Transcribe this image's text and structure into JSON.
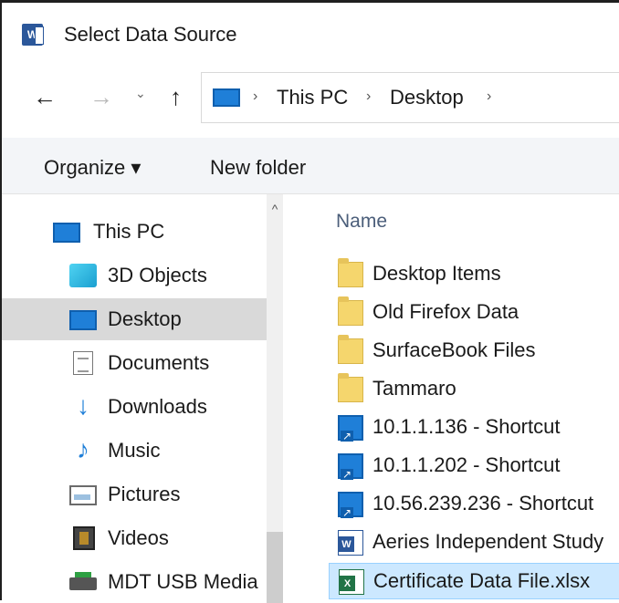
{
  "window": {
    "title": "Select Data Source",
    "app_icon": "word-icon"
  },
  "nav": {
    "back": "←",
    "forward": "→",
    "recent": "⌄",
    "up": "↑",
    "breadcrumb": [
      "This PC",
      "Desktop"
    ],
    "sep": "›",
    "trailing_sep": "›"
  },
  "commands": {
    "organize": "Organize ▾",
    "new_folder": "New folder"
  },
  "sidebar": {
    "scroll_up": "^",
    "items": [
      {
        "label": "This PC",
        "icon": "pc-icon"
      },
      {
        "label": "3D Objects",
        "icon": "3d-objects-icon"
      },
      {
        "label": "Desktop",
        "icon": "desktop-icon",
        "selected": true
      },
      {
        "label": "Documents",
        "icon": "documents-icon"
      },
      {
        "label": "Downloads",
        "icon": "download-arrow-icon",
        "glyph": "↓"
      },
      {
        "label": "Music",
        "icon": "music-note-icon",
        "glyph": "♪"
      },
      {
        "label": "Pictures",
        "icon": "pictures-icon"
      },
      {
        "label": "Videos",
        "icon": "videos-icon"
      },
      {
        "label": "MDT USB Media",
        "icon": "usb-drive-icon"
      }
    ]
  },
  "files": {
    "column_name": "Name",
    "items": [
      {
        "name": "Desktop Items",
        "type": "folder"
      },
      {
        "name": "Old Firefox Data",
        "type": "folder"
      },
      {
        "name": "SurfaceBook Files",
        "type": "folder"
      },
      {
        "name": "Tammaro",
        "type": "folder"
      },
      {
        "name": "10.1.1.136 - Shortcut",
        "type": "shortcut"
      },
      {
        "name": "10.1.1.202 - Shortcut",
        "type": "shortcut"
      },
      {
        "name": "10.56.239.236 - Shortcut",
        "type": "shortcut"
      },
      {
        "name": "Aeries Independent Study",
        "type": "word"
      },
      {
        "name": "Certificate Data File.xlsx",
        "type": "excel",
        "selected": true
      }
    ]
  }
}
